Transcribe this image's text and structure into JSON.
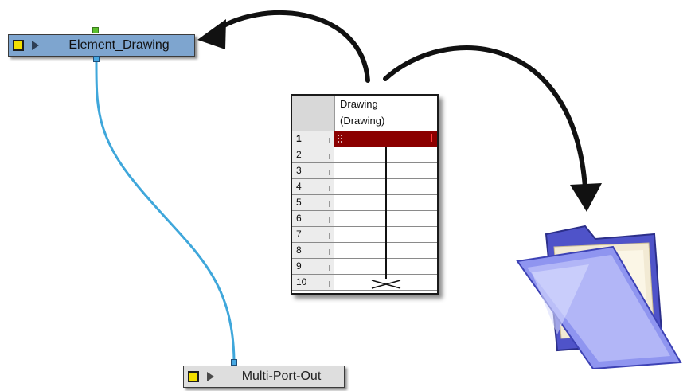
{
  "nodes": {
    "element": {
      "label": "Element_Drawing",
      "color": "#7ea5cf"
    },
    "multiport": {
      "label": "Multi-Port-Out",
      "color": "#dedede"
    }
  },
  "xsheet": {
    "column_title": "Drawing",
    "column_subtitle": "(Drawing)",
    "frames": [
      "1",
      "2",
      "3",
      "4",
      "5",
      "6",
      "7",
      "8",
      "9",
      "10"
    ],
    "current_frame_color": "#8b0000"
  },
  "icons": {
    "folder": "folder-icon",
    "arrows": [
      "curved-arrow-to-node",
      "curved-arrow-to-folder"
    ]
  },
  "colors": {
    "cable": "#3fa7db",
    "arrow": "#111111"
  }
}
